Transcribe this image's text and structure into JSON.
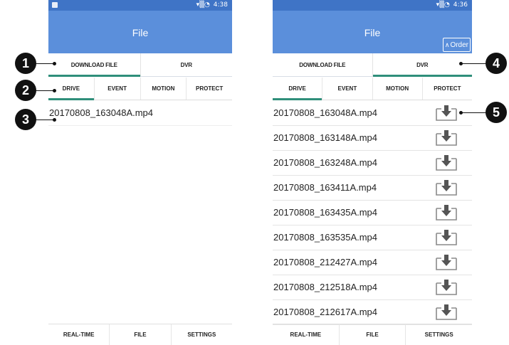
{
  "left_screen": {
    "status": {
      "time": "4:38"
    },
    "appbar_title": "File",
    "main_tabs": [
      "DOWNLOAD FILE",
      "DVR"
    ],
    "sub_tabs": [
      "DRIVE",
      "EVENT",
      "MOTION",
      "PROTECT"
    ],
    "files": [
      "20170808_163048A.mp4"
    ],
    "bottom_nav": [
      "REAL-TIME",
      "FILE",
      "SETTINGS"
    ]
  },
  "right_screen": {
    "status": {
      "time": "4:36"
    },
    "appbar_title": "File",
    "order_label": "Order",
    "main_tabs": [
      "DOWNLOAD FILE",
      "DVR"
    ],
    "sub_tabs": [
      "DRIVE",
      "EVENT",
      "MOTION",
      "PROTECT"
    ],
    "files": [
      "20170808_163048A.mp4",
      "20170808_163148A.mp4",
      "20170808_163248A.mp4",
      "20170808_163411A.mp4",
      "20170808_163435A.mp4",
      "20170808_163535A.mp4",
      "20170808_212427A.mp4",
      "20170808_212518A.mp4",
      "20170808_212617A.mp4"
    ],
    "bottom_nav": [
      "REAL-TIME",
      "FILE",
      "SETTINGS"
    ]
  },
  "callouts": [
    "1",
    "2",
    "3",
    "4",
    "5"
  ],
  "colors": {
    "appbar": "#5b8fdb",
    "statusbar": "#3f74c6",
    "tab_indicator": "#2f8f7a",
    "callout": "#111111"
  },
  "icons": {
    "download": "download-tray-icon",
    "order": "chevron-up-icon"
  }
}
